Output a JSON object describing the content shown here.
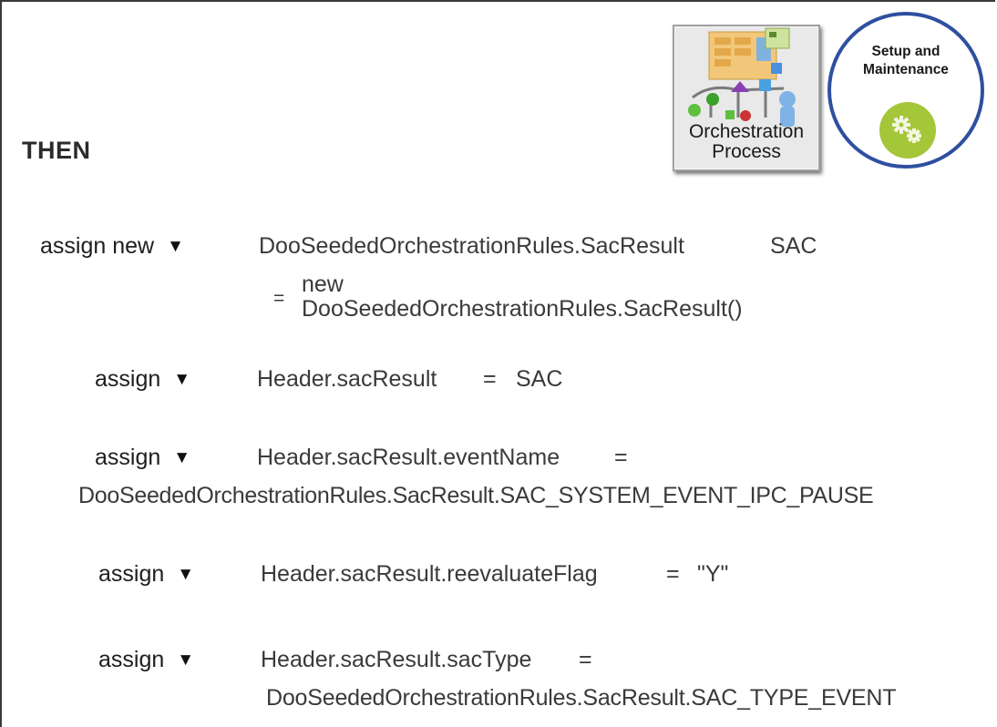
{
  "heading": "THEN",
  "tiles": {
    "orchestration": {
      "line1": "Orchestration",
      "line2": "Process",
      "icon": "orchestration-diagram-icon"
    },
    "setup": {
      "line1": "Setup and",
      "line2": "Maintenance",
      "icon": "gears-icon",
      "accent": "#a4c639",
      "ring": "#2f4fa0"
    }
  },
  "rules": [
    {
      "keyword": "assign new",
      "lhs": "DooSeededOrchestrationRules.SacResult",
      "var": "SAC",
      "eq": "=",
      "rhs1": "new",
      "rhs2": "DooSeededOrchestrationRules.SacResult()"
    },
    {
      "keyword": "assign",
      "lhs": "Header.sacResult",
      "eq": "=",
      "rhs": "SAC"
    },
    {
      "keyword": "assign",
      "lhs": "Header.sacResult.eventName",
      "eq": "=",
      "rhs": "DooSeededOrchestrationRules.SacResult.SAC_SYSTEM_EVENT_IPC_PAUSE"
    },
    {
      "keyword": "assign",
      "lhs": "Header.sacResult.reevaluateFlag",
      "eq": "=",
      "rhs": "\"Y\""
    },
    {
      "keyword": "assign",
      "lhs": "Header.sacResult.sacType",
      "eq": "=",
      "rhs": "DooSeededOrchestrationRules.SacResult.SAC_TYPE_EVENT"
    }
  ],
  "dropdown_icon": "triangle-down-icon"
}
